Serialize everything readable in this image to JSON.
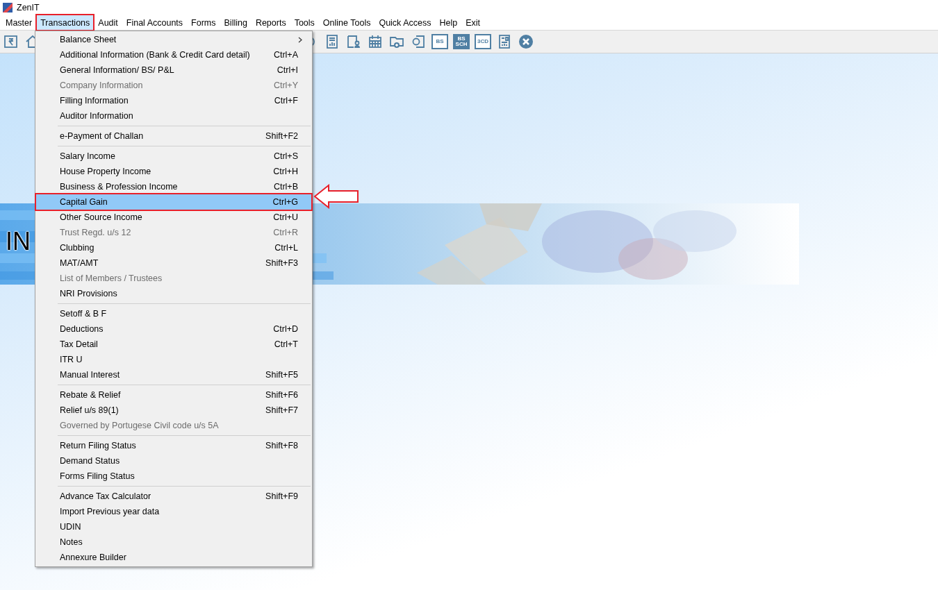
{
  "window": {
    "title": "ZenIT"
  },
  "menu_bar": [
    {
      "label": "Master",
      "selected": false,
      "annotated": false
    },
    {
      "label": "Transactions",
      "selected": true,
      "annotated": true
    },
    {
      "label": "Audit",
      "selected": false,
      "annotated": false
    },
    {
      "label": "Final Accounts",
      "selected": false,
      "annotated": false
    },
    {
      "label": "Forms",
      "selected": false,
      "annotated": false
    },
    {
      "label": "Billing",
      "selected": false,
      "annotated": false
    },
    {
      "label": "Reports",
      "selected": false,
      "annotated": false
    },
    {
      "label": "Tools",
      "selected": false,
      "annotated": false
    },
    {
      "label": "Online Tools",
      "selected": false,
      "annotated": false
    },
    {
      "label": "Quick Access",
      "selected": false,
      "annotated": false
    },
    {
      "label": "Help",
      "selected": false,
      "annotated": false
    },
    {
      "label": "Exit",
      "selected": false,
      "annotated": false
    }
  ],
  "toolbar_left": [
    {
      "kind": "rupee"
    },
    {
      "kind": "home"
    }
  ],
  "toolbar_right": [
    {
      "kind": "chat"
    },
    {
      "kind": "report"
    },
    {
      "kind": "person"
    },
    {
      "kind": "calendar"
    },
    {
      "kind": "folder"
    },
    {
      "kind": "document"
    },
    {
      "kind": "badge",
      "label": "BS"
    },
    {
      "kind": "badge2",
      "label": "BS",
      "sublabel": "SCH"
    },
    {
      "kind": "badge",
      "label": "3CD"
    },
    {
      "kind": "grid"
    },
    {
      "kind": "close"
    }
  ],
  "banner": {
    "title": "IN"
  },
  "dropdown": [
    {
      "kind": "item",
      "label": "Balance Sheet",
      "submenu": true,
      "disabled": false,
      "selected": false,
      "annotated": false
    },
    {
      "kind": "item",
      "label": "Additional Information (Bank & Credit Card detail)",
      "shortcut": "Ctrl+A",
      "disabled": false,
      "selected": false,
      "annotated": false
    },
    {
      "kind": "item",
      "label": "General Information/ BS/ P&L",
      "shortcut": "Ctrl+I",
      "disabled": false,
      "selected": false,
      "annotated": false
    },
    {
      "kind": "item",
      "label": "Company Information",
      "shortcut": "Ctrl+Y",
      "disabled": true,
      "selected": false,
      "annotated": false
    },
    {
      "kind": "item",
      "label": "Filling Information",
      "shortcut": "Ctrl+F",
      "disabled": false,
      "selected": false,
      "annotated": false
    },
    {
      "kind": "item",
      "label": "Auditor Information",
      "disabled": false,
      "selected": false,
      "annotated": false
    },
    {
      "kind": "separator"
    },
    {
      "kind": "item",
      "label": "e-Payment of Challan",
      "shortcut": "Shift+F2",
      "disabled": false,
      "selected": false,
      "annotated": false
    },
    {
      "kind": "separator"
    },
    {
      "kind": "item",
      "label": "Salary Income",
      "shortcut": "Ctrl+S",
      "disabled": false,
      "selected": false,
      "annotated": false
    },
    {
      "kind": "item",
      "label": "House Property Income",
      "shortcut": "Ctrl+H",
      "disabled": false,
      "selected": false,
      "annotated": false
    },
    {
      "kind": "item",
      "label": "Business & Profession Income",
      "shortcut": "Ctrl+B",
      "disabled": false,
      "selected": false,
      "annotated": false
    },
    {
      "kind": "item",
      "label": "Capital Gain",
      "shortcut": "Ctrl+G",
      "disabled": false,
      "selected": true,
      "annotated": true
    },
    {
      "kind": "item",
      "label": "Other Source Income",
      "shortcut": "Ctrl+U",
      "disabled": false,
      "selected": false,
      "annotated": false
    },
    {
      "kind": "item",
      "label": "Trust Regd. u/s 12",
      "shortcut": "Ctrl+R",
      "disabled": true,
      "selected": false,
      "annotated": false
    },
    {
      "kind": "item",
      "label": "Clubbing",
      "shortcut": "Ctrl+L",
      "disabled": false,
      "selected": false,
      "annotated": false
    },
    {
      "kind": "item",
      "label": "MAT/AMT",
      "shortcut": "Shift+F3",
      "disabled": false,
      "selected": false,
      "annotated": false
    },
    {
      "kind": "item",
      "label": "List of Members / Trustees",
      "disabled": true,
      "selected": false,
      "annotated": false
    },
    {
      "kind": "item",
      "label": "NRI Provisions",
      "disabled": false,
      "selected": false,
      "annotated": false
    },
    {
      "kind": "separator"
    },
    {
      "kind": "item",
      "label": "Setoff & B F",
      "disabled": false,
      "selected": false,
      "annotated": false
    },
    {
      "kind": "item",
      "label": "Deductions",
      "shortcut": "Ctrl+D",
      "disabled": false,
      "selected": false,
      "annotated": false
    },
    {
      "kind": "item",
      "label": "Tax Detail",
      "shortcut": "Ctrl+T",
      "disabled": false,
      "selected": false,
      "annotated": false
    },
    {
      "kind": "item",
      "label": "ITR U",
      "disabled": false,
      "selected": false,
      "annotated": false
    },
    {
      "kind": "item",
      "label": "Manual Interest",
      "shortcut": "Shift+F5",
      "disabled": false,
      "selected": false,
      "annotated": false
    },
    {
      "kind": "separator"
    },
    {
      "kind": "item",
      "label": "Rebate & Relief",
      "shortcut": "Shift+F6",
      "disabled": false,
      "selected": false,
      "annotated": false
    },
    {
      "kind": "item",
      "label": "Relief u/s 89(1)",
      "shortcut": "Shift+F7",
      "disabled": false,
      "selected": false,
      "annotated": false
    },
    {
      "kind": "item",
      "label": "Governed by Portugese Civil code u/s 5A",
      "disabled": true,
      "selected": false,
      "annotated": false
    },
    {
      "kind": "separator"
    },
    {
      "kind": "item",
      "label": "Return Filing Status",
      "shortcut": "Shift+F8",
      "disabled": false,
      "selected": false,
      "annotated": false
    },
    {
      "kind": "item",
      "label": "Demand Status",
      "disabled": false,
      "selected": false,
      "annotated": false
    },
    {
      "kind": "item",
      "label": "Forms Filing Status",
      "disabled": false,
      "selected": false,
      "annotated": false
    },
    {
      "kind": "separator"
    },
    {
      "kind": "item",
      "label": "Advance Tax Calculator",
      "shortcut": "Shift+F9",
      "disabled": false,
      "selected": false,
      "annotated": false
    },
    {
      "kind": "item",
      "label": "Import Previous year data",
      "disabled": false,
      "selected": false,
      "annotated": false
    },
    {
      "kind": "item",
      "label": "UDIN",
      "disabled": false,
      "selected": false,
      "annotated": false
    },
    {
      "kind": "item",
      "label": "Notes",
      "disabled": false,
      "selected": false,
      "annotated": false
    },
    {
      "kind": "item",
      "label": "Annexure Builder",
      "disabled": false,
      "selected": false,
      "annotated": false
    }
  ]
}
